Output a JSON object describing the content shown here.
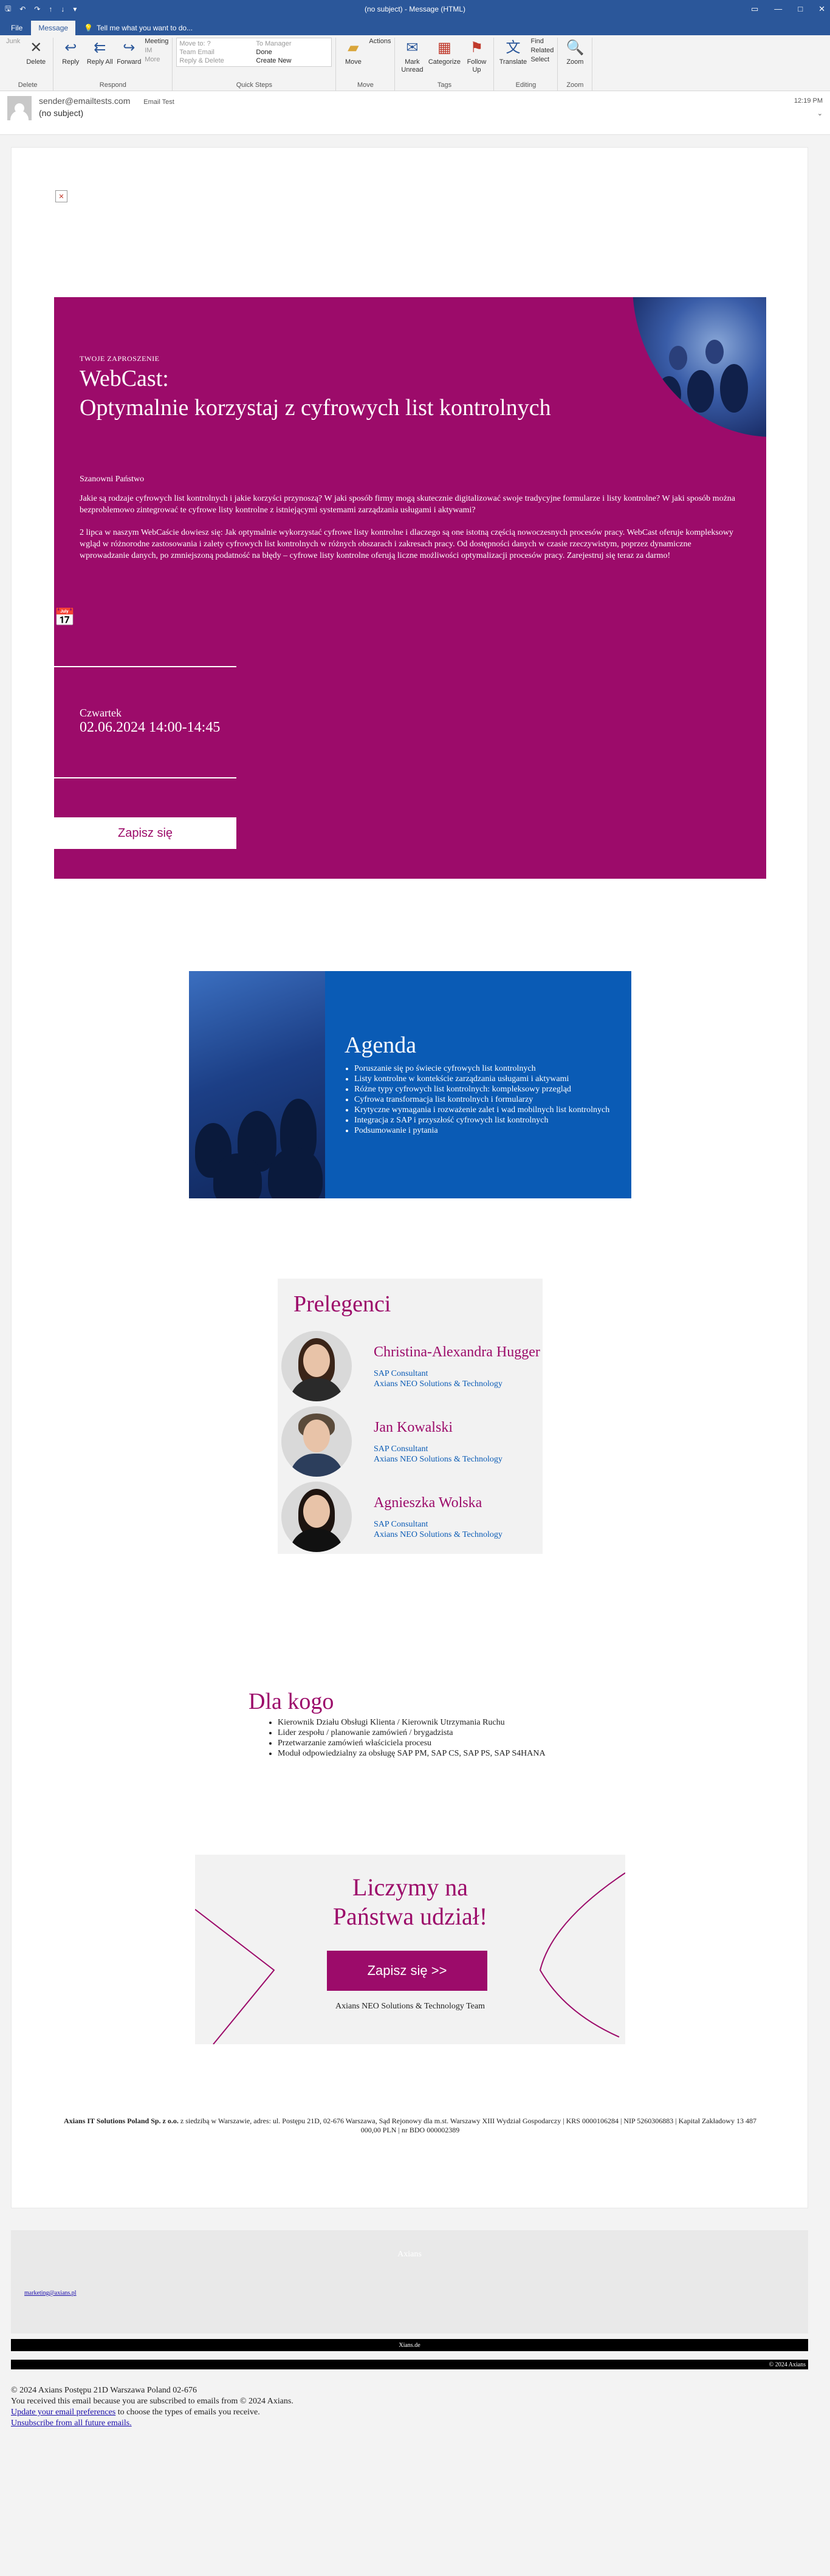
{
  "window": {
    "title": "(no subject)  -  Message (HTML)",
    "controls": [
      "—",
      "□",
      "✕"
    ],
    "help": "?"
  },
  "tabs": [
    {
      "label": "File"
    },
    {
      "label": "Message"
    }
  ],
  "tell_me": "Tell me what you want to do...",
  "ribbon": {
    "delete": {
      "junk": "Junk",
      "delete": "Delete",
      "group": "Delete"
    },
    "respond": {
      "reply": "Reply",
      "reply_all": "Reply All",
      "forward": "Forward",
      "meeting": "Meeting",
      "im": "IM",
      "more": "More",
      "group": "Respond"
    },
    "quick_steps": {
      "items": [
        "Move to: ?",
        "To Manager",
        "Team Email",
        "Done",
        "Reply & Delete",
        "Create New"
      ],
      "group": "Quick Steps"
    },
    "move": {
      "move": "Move",
      "actions": "Actions",
      "group": "Move"
    },
    "tags": {
      "mark_unread": "Mark Unread",
      "categorize": "Categorize",
      "follow_up": "Follow Up",
      "group": "Tags"
    },
    "editing": {
      "translate": "Translate",
      "find": "Find",
      "related": "Related",
      "select": "Select",
      "group": "Editing"
    },
    "zoom": {
      "zoom": "Zoom",
      "group": "Zoom"
    }
  },
  "message": {
    "from": "sender@emailtests.com",
    "from_label": "Email Test",
    "subject": "(no subject)",
    "time": "12:19 PM"
  },
  "email": {
    "hero": {
      "kicker": "TWOJE ZAPROSZENIE",
      "title_line1": "WebCast:",
      "title_line2": "Optymalnie korzystaj z cyfrowych list kontrolnych",
      "salutation": "Szanowni Państwo",
      "para1": "Jakie są rodzaje cyfrowych list kontrolnych i jakie korzyści przynoszą? W jaki sposób firmy mogą skutecznie digitalizować swoje tradycyjne formularze i listy kontrolne? W jaki sposób można bezproblemowo zintegrować te cyfrowe listy kontrolne z istniejącymi systemami zarządzania usługami i aktywami?",
      "para2": "2 lipca w naszym WebCaście dowiesz się: Jak optymalnie wykorzystać cyfrowe listy kontrolne i dlaczego są one istotną częścią nowoczesnych procesów pracy. WebCast oferuje kompleksowy wgląd w różnorodne zastosowania i zalety cyfrowych list kontrolnych w różnych obszarach i zakresach pracy. Od dostępności danych w czasie rzeczywistym, poprzez dynamiczne wprowadzanie danych, po zmniejszoną podatność na błędy – cyfrowe listy kontrolne oferują liczne możliwości optymalizacji procesów pracy. Zarejestruj się teraz za darmo!",
      "day": "Czwartek",
      "datetime": "02.06.2024 14:00-14:45",
      "cta": "Zapisz się"
    },
    "agenda": {
      "title": "Agenda",
      "items": [
        "Poruszanie się po świecie cyfrowych list kontrolnych",
        "Listy kontrolne w kontekście zarządzania usługami i aktywami",
        "Różne typy cyfrowych list kontrolnych: kompleksowy przegląd",
        "Cyfrowa transformacja list kontrolnych i formularzy",
        "Krytyczne wymagania i rozważenie zalet i wad mobilnych list kontrolnych",
        "Integracja z SAP i przyszłość cyfrowych list kontrolnych",
        "Podsumowanie i pytania"
      ]
    },
    "speakers": {
      "title": "Prelegenci",
      "people": [
        {
          "name": "Christina-Alexandra Hugger",
          "role": "SAP Consultant",
          "company": "Axians NEO Solutions & Technology"
        },
        {
          "name": "Jan Kowalski",
          "role": "SAP Consultant",
          "company": "Axians NEO Solutions & Technology"
        },
        {
          "name": "Agnieszka Wolska",
          "role": "SAP Consultant",
          "company": "Axians NEO Solutions & Technology"
        }
      ]
    },
    "audience": {
      "title": "Dla kogo",
      "items": [
        "Kierownik Działu Obsługi Klienta / Kierownik Utrzymania Ruchu",
        "Lider zespołu / planowanie zamówień / brygadzista",
        "Przetwarzanie zamówień właściciela procesu",
        "Moduł odpowiedzialny za obsługę SAP PM, SAP CS, SAP PS, SAP S4HANA"
      ]
    },
    "join": {
      "title_line1": "Liczymy na",
      "title_line2": "Państwa udział!",
      "cta": "Zapisz się >>",
      "signature": "Axians NEO Solutions & Technology Team"
    },
    "legal": {
      "company": "Axians IT Solutions Poland Sp. z o.o.",
      "text": " z siedzibą w Warszawie, adres: ul. Postępu 21D, 02-676 Warszawa, Sąd Rejonowy dla m.st. Warszawy XIII Wydział Gospodarczy | KRS 0000106284 | NIP 5260306883 | Kapitał Zakładowy 13 487 000,00 PLN | nr BDO 000002389"
    },
    "footer": {
      "ghost": "Axians",
      "email": "marketing@axians.pl",
      "bar1": "Xians.de",
      "bar2": "© 2024 Axians",
      "address": "© 2024 Axians  Postępu 21D    Warszawa  Poland  02-676",
      "notice": "You received this email because you are subscribed to emails from © 2024 Axians.",
      "prefs_link": "Update your email preferences",
      "prefs_rest": " to choose the types of emails you receive.",
      "unsub": "Unsubscribe from all future emails."
    }
  },
  "colors": {
    "brand_magenta": "#9c0b6a",
    "brand_blue": "#0a5bb5",
    "outlook_blue": "#2b579a"
  }
}
